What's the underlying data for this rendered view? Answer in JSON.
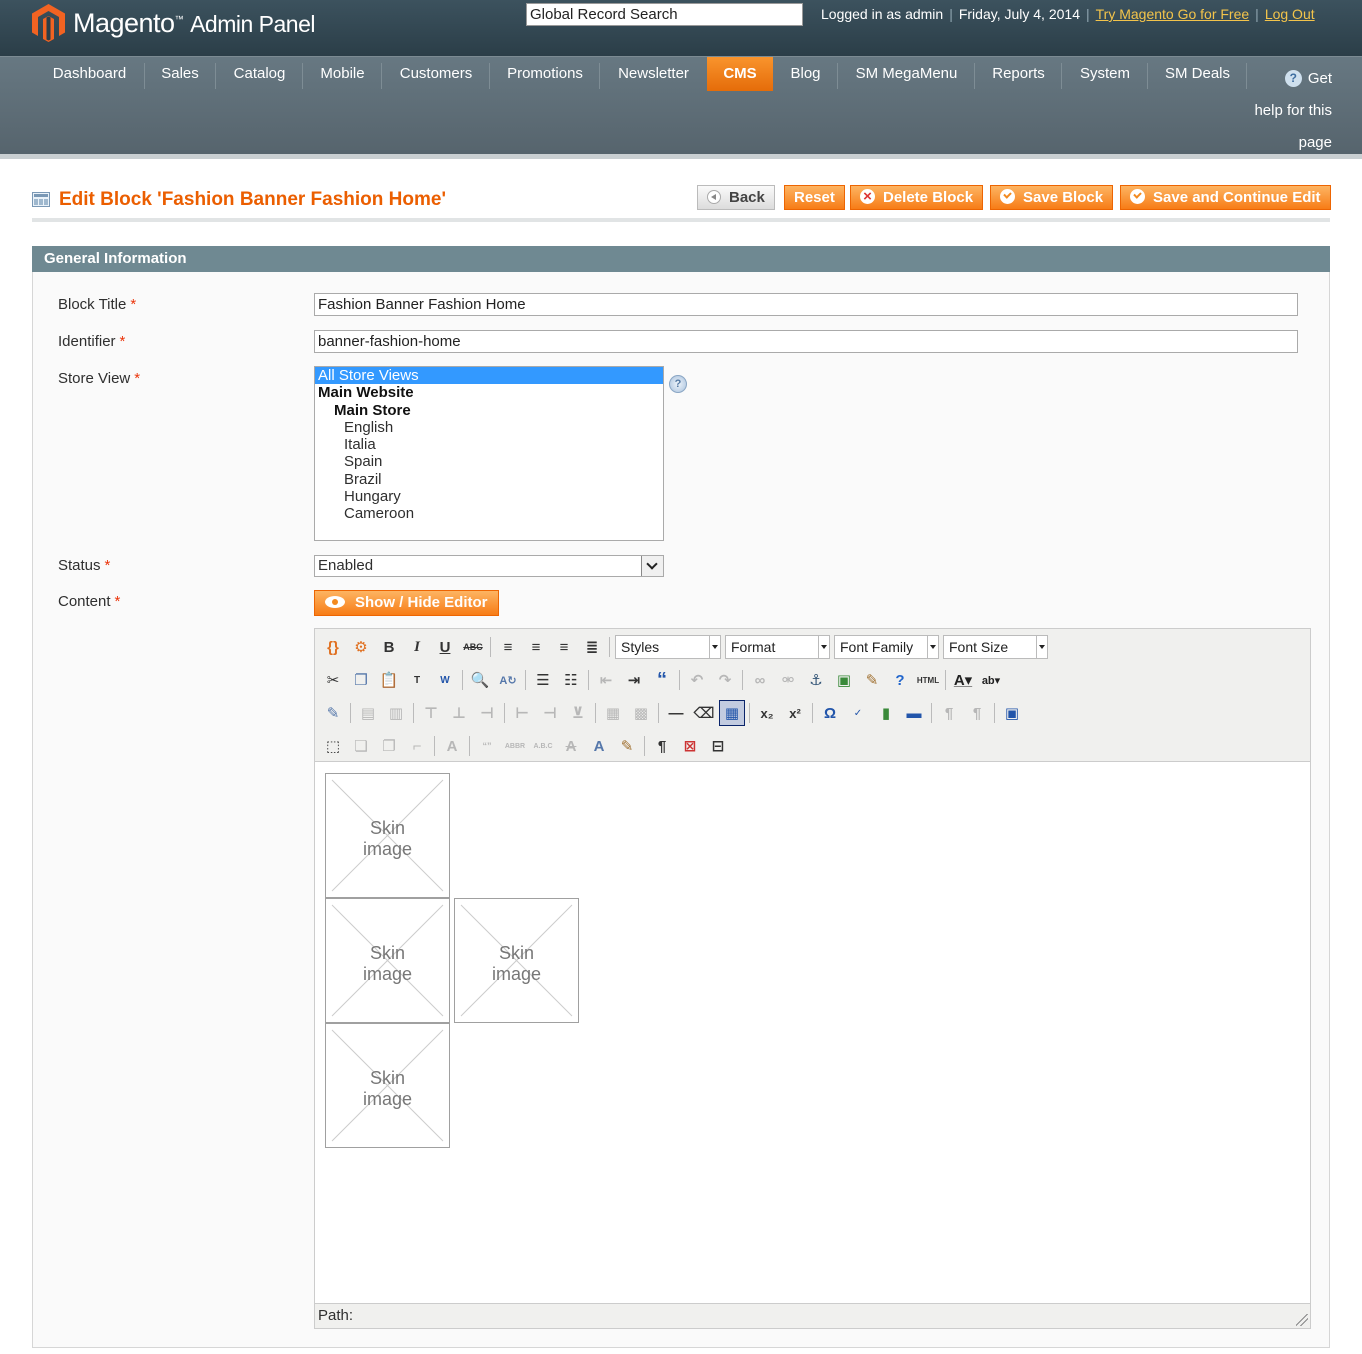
{
  "header": {
    "logo_main": "Magento",
    "logo_sub": "Admin Panel",
    "search_value": "Global Record Search",
    "logged_in": "Logged in as admin",
    "date": "Friday, July 4, 2014",
    "try_link": "Try Magento Go for Free",
    "logout": "Log Out"
  },
  "nav": {
    "items": [
      "Dashboard",
      "Sales",
      "Catalog",
      "Mobile",
      "Customers",
      "Promotions",
      "Newsletter",
      "CMS",
      "Blog",
      "SM MegaMenu",
      "Reports",
      "System",
      "SM Deals"
    ],
    "active": "CMS",
    "help_lines": [
      "Get",
      "help for this",
      "page"
    ]
  },
  "page": {
    "title": "Edit Block 'Fashion Banner Fashion Home'",
    "buttons": {
      "back": "Back",
      "reset": "Reset",
      "delete": "Delete Block",
      "save": "Save Block",
      "save_continue": "Save and Continue Edit"
    }
  },
  "form": {
    "section_title": "General Information",
    "block_title_label": "Block Title",
    "block_title_value": "Fashion Banner Fashion Home",
    "identifier_label": "Identifier",
    "identifier_value": "banner-fashion-home",
    "store_view_label": "Store View",
    "store_views": {
      "all": "All Store Views",
      "website": "Main Website",
      "store": "Main Store",
      "views": [
        "English",
        "Italia",
        "Spain",
        "Brazil",
        "Hungary",
        "Cameroon"
      ]
    },
    "status_label": "Status",
    "status_value": "Enabled",
    "content_label": "Content",
    "toggle_editor": "Show / Hide Editor",
    "required_mark": "*"
  },
  "editor": {
    "dropdowns": {
      "styles": "Styles",
      "format": "Format",
      "font_family": "Font Family",
      "font_size": "Font Size"
    },
    "skin_image_line1": "Skin",
    "skin_image_line2": "image",
    "path_label": "Path:"
  },
  "colors": {
    "accent": "#eb5e00",
    "button_orange": "#f77c16",
    "header_bg": "#2b3e48",
    "nav_bg": "#5e6e77",
    "section_bg": "#6f8992"
  }
}
